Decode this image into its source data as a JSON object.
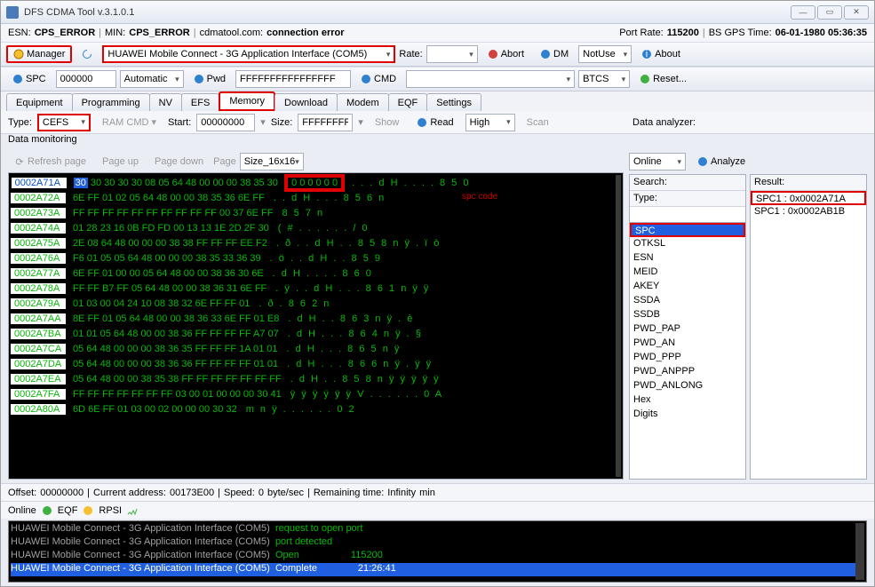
{
  "window": {
    "title": "DFS CDMA Tool v.3.1.0.1"
  },
  "status": {
    "esn_label": "ESN:",
    "esn": "CPS_ERROR",
    "min_label": "MIN:",
    "min": "CPS_ERROR",
    "site": "cdmatool.com:",
    "conn": "connection error",
    "portrate_label": "Port Rate:",
    "portrate": "115200",
    "gps_label": "BS GPS Time:",
    "gps": "06-01-1980 05:36:35"
  },
  "toolbar1": {
    "manager": "Manager",
    "device": "HUAWEI Mobile Connect - 3G Application Interface (COM5)",
    "rate": "Rate:",
    "abort": "Abort",
    "dm": "DM",
    "dm_sel": "NotUse",
    "about": "About"
  },
  "toolbar2": {
    "spc": "SPC",
    "spc_val": "000000",
    "spc_mode": "Automatic",
    "pwd": "Pwd",
    "pwd_val": "FFFFFFFFFFFFFFFF",
    "cmd": "CMD",
    "btcs": "BTCS",
    "reset": "Reset..."
  },
  "tabs": [
    "Equipment",
    "Programming",
    "NV",
    "EFS",
    "Memory",
    "Download",
    "Modem",
    "EQF",
    "Settings"
  ],
  "active_tab": "Memory",
  "membar": {
    "type_label": "Type:",
    "type": "CEFS",
    "ramcmd": "RAM CMD",
    "start_label": "Start:",
    "start": "00000000",
    "size_label": "Size:",
    "size": "FFFFFFFF",
    "show": "Show",
    "read": "Read",
    "level": "High",
    "scan": "Scan"
  },
  "monitor_label": "Data monitoring",
  "hexbar": {
    "refresh": "Refresh page",
    "pageup": "Page up",
    "pagedown": "Page down",
    "page_label": "Page",
    "page": "Size_16x16"
  },
  "hex": {
    "addrs": [
      "0002A71A",
      "0002A72A",
      "0002A73A",
      "0002A74A",
      "0002A75A",
      "0002A76A",
      "0002A77A",
      "0002A78A",
      "0002A79A",
      "0002A7AA",
      "0002A7BA",
      "0002A7CA",
      "0002A7DA",
      "0002A7EA",
      "0002A7FA",
      "0002A80A"
    ],
    "first_sel": "30",
    "bytes": [
      "30 30 30 30 08 05 64 48 00 00 00 38 35 30",
      "6E FF 01 02 05 64 48 00 00 38 35 36 6E FF",
      "FF FF FF FF FF FF FF FF FF FF 00 37 6E FF",
      "01 28 23 16 0B FD FD 00 13 13 1E 2D 2F 30",
      "2E 08 64 48 00 00 00 38 38 FF FF FF EE F2",
      "F6 01 05 05 64 48 00 00 00 38 35 33 36 39",
      "6E FF 01 00 00 05 64 48 00 00 38 36 30 6E",
      "FF FF B7 FF 05 64 48 00 00 38 36 31 6E FF",
      "01 03 00 04 24 10 08 38 32 6E FF FF 01",
      "8E FF 01 05 64 48 00 00 38 36 33 6E FF 01 E8",
      "01 01 05 64 48 00 00 38 36 FF FF FF FF A7 07",
      "05 64 48 00 00 00 38 36 35 FF FF FF 1A 01 01",
      "05 64 48 00 00 00 38 36 36 FF FF FF FF 01 01",
      "05 64 48 00 00 38 35 38 FF FF FF FF FF FF FF",
      "FF FF FF FF FF FF FF 03 00 01 00 00 00 30 41",
      "6D 6E FF 01 03 00 02 00 00 00 30 32"
    ],
    "greenbox": "0 0 0 0 0 0",
    "spc_code_label": "spc code",
    "ascii": [
      ". . . d H . . . . 8 5 0",
      ". . d H . . . 8 5 6 n",
      "8 5 7 n",
      "( # . . . . . . / 0",
      ". ð . . d H . . 8 5 8 n ÿ . ï ò",
      ". ö . . d H . . 8 5 9",
      ". d H . . . . 8 6 0",
      ". ÿ . . d H . . . 8 6 1 n ÿ ÿ",
      ". ð . 8 6 2 n",
      ". d H . . 8 6 3 n ÿ . è",
      ". d H . . . 8 6 4 n ÿ . §",
      ". d H . . . 8 6 5 n ÿ",
      ". d H . . . 8 6 6 n ÿ . ÿ ÿ",
      ". d H . . 8 5 8 n ÿ ÿ ÿ ÿ ÿ",
      "ÿ ÿ ÿ ÿ ÿ ÿ V . . . . . . 0 A",
      "m n ÿ . . . . . . 0 2"
    ]
  },
  "analyzer": {
    "label": "Data analyzer:",
    "mode": "Online",
    "analyze": "Analyze",
    "search": "Search:",
    "type": "Type:",
    "result": "Result:"
  },
  "types": [
    "OTKSL",
    "ESN",
    "MEID",
    "AKEY",
    "SSDA",
    "SSDB",
    "PWD_PAP",
    "PWD_AN",
    "PWD_PPP",
    "PWD_ANPPP",
    "PWD_ANLONG",
    "Hex",
    "Digits"
  ],
  "type_sel": "SPC",
  "results": [
    "SPC1 : 0x0002A71A",
    "SPC1 : 0x0002AB1B"
  ],
  "footer": {
    "offset_l": "Offset:",
    "offset": "00000000",
    "cur_l": "Current address:",
    "cur": "00173E00",
    "speed_l": "Speed:",
    "speed": "0",
    "unit": "byte/sec",
    "rem_l": "Remaining time:",
    "rem": "Infinity",
    "rem_u": "min"
  },
  "onlinebar": {
    "online": "Online",
    "eqf": "EQF",
    "rpsi": "RPSI"
  },
  "log": [
    {
      "t": "HUAWEI Mobile Connect - 3G Application Interface (COM5)",
      "m": "request to open port",
      "v": ""
    },
    {
      "t": "HUAWEI Mobile Connect - 3G Application Interface (COM5)",
      "m": "port detected",
      "v": ""
    },
    {
      "t": "HUAWEI Mobile Connect - 3G Application Interface (COM5)",
      "m": "Open",
      "v": "115200"
    },
    {
      "t": "HUAWEI Mobile Connect - 3G Application Interface (COM5)",
      "m": "Complete",
      "v": "21:26:41"
    }
  ]
}
